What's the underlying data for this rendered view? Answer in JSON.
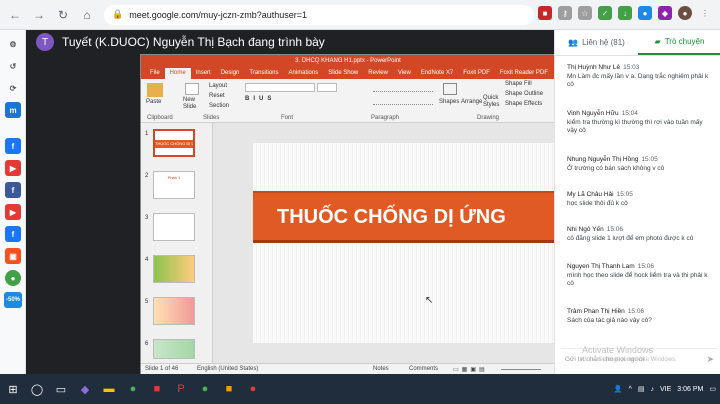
{
  "browser": {
    "url": "meet.google.com/muy-jczn-zmb?authuser=1",
    "back": "←",
    "forward": "→",
    "reload": "↻",
    "home": "⌂"
  },
  "meeting": {
    "avatar_initial": "T",
    "presenter_text": "Tuyết (K.DUOC) Nguyễn Thị Bạch đang trình bày"
  },
  "ppt": {
    "title": "3. DHCQ KHANG H1.pptx - PowerPoint",
    "tabs": [
      "File",
      "Home",
      "Insert",
      "Design",
      "Transitions",
      "Animations",
      "Slide Show",
      "Review",
      "View",
      "EndNote X7",
      "Foxit PDF",
      "Foxit Reader PDF"
    ],
    "groups": {
      "clipboard": "Clipboard",
      "slides": "Slides",
      "font": "Font",
      "paragraph": "Paragraph",
      "drawing": "Drawing"
    },
    "buttons": {
      "paste": "Paste",
      "new_slide": "New Slide",
      "layout": "Layout",
      "reset": "Reset",
      "section": "Section",
      "shapes": "Shapes",
      "arrange": "Arrange",
      "quick_styles": "Quick Styles",
      "shape_fill": "Shape Fill",
      "shape_outline": "Shape Outline",
      "shape_effects": "Shape Effects"
    },
    "slide_numbers": [
      "1",
      "2",
      "3",
      "4",
      "5",
      "6"
    ],
    "slide1_title": "THUỐC CHỐNG DỊ ỨNG",
    "thumb2_title": "Phần 1",
    "status_slide": "Slide 1 of 46",
    "status_lang": "English (United States)",
    "status_notes": "Notes",
    "status_comments": "Comments"
  },
  "chat": {
    "tab_people": "Liên hệ (81)",
    "tab_chat": "Trò chuyện",
    "messages": [
      {
        "name": "Thị Huỳnh Như Lê",
        "time": "15:03",
        "text": "Mn Làm đc mấy lần v a. Dạng trắc nghiệm phải k cô"
      },
      {
        "name": "Vinh Nguyễn Hữu",
        "time": "15:04",
        "text": "kiểm tra thường kì thường thì rơi vào tuần mấy vậy cô"
      },
      {
        "name": "Nhung Nguyễn Thị Hồng",
        "time": "15:05",
        "text": "Ở trường có bán sách không v cô"
      },
      {
        "name": "My Lã Châu Hải",
        "time": "15:05",
        "text": "học slide thôi đủ k cô"
      },
      {
        "name": "Nhi Ngô Yến",
        "time": "15:06",
        "text": "cô đăng slide 1 lượt để em photo được k cô"
      },
      {
        "name": "Nguyen Thị Thanh Lam",
        "time": "15:06",
        "text": "mình học theo slide để hock liểm tra và thi phải k cô"
      },
      {
        "name": "Trâm Phan Thị Hiền",
        "time": "15:06",
        "text": "Sách của tác giả nào vậy cô?"
      }
    ],
    "input_placeholder": "Gửi tin nhắn cho mọi người"
  },
  "watermark": {
    "line1": "Activate Windows",
    "line2": "Go to Settings to activate Windows."
  },
  "taskbar": {
    "lang": "VIE",
    "time": "3:06 PM"
  },
  "rail_badge": "-50%",
  "colors": {
    "ppt_orange": "#d24726",
    "banner": "#e05a24",
    "meet_bg": "#202124",
    "chat_green": "#1e8e3e"
  }
}
